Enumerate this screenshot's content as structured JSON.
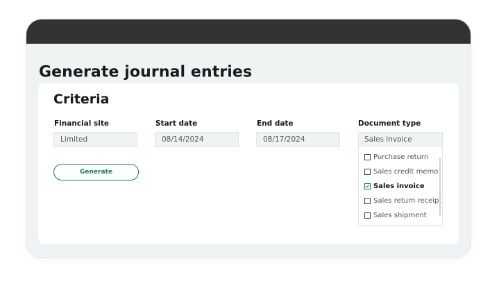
{
  "page": {
    "title": "Generate journal entries"
  },
  "criteria": {
    "heading": "Criteria",
    "financial_site": {
      "label": "Financial site",
      "placeholder": "Limited"
    },
    "start_date": {
      "label": "Start date",
      "value": "08/14/2024"
    },
    "end_date": {
      "label": "End date",
      "value": "08/17/2024"
    },
    "document_type": {
      "label": "Document type",
      "placeholder": "Sales invoice",
      "options": [
        {
          "label": "Purchase return",
          "checked": false
        },
        {
          "label": "Sales credit memo",
          "checked": false
        },
        {
          "label": "Sales invoice",
          "checked": true
        },
        {
          "label": "Sales return receipt",
          "checked": false
        },
        {
          "label": "Sales shipment",
          "checked": false
        }
      ]
    },
    "generate_label": "Generate"
  },
  "colors": {
    "accent": "#1e7e4e",
    "titlebar": "#323232",
    "page_background": "#f0f3f4"
  }
}
